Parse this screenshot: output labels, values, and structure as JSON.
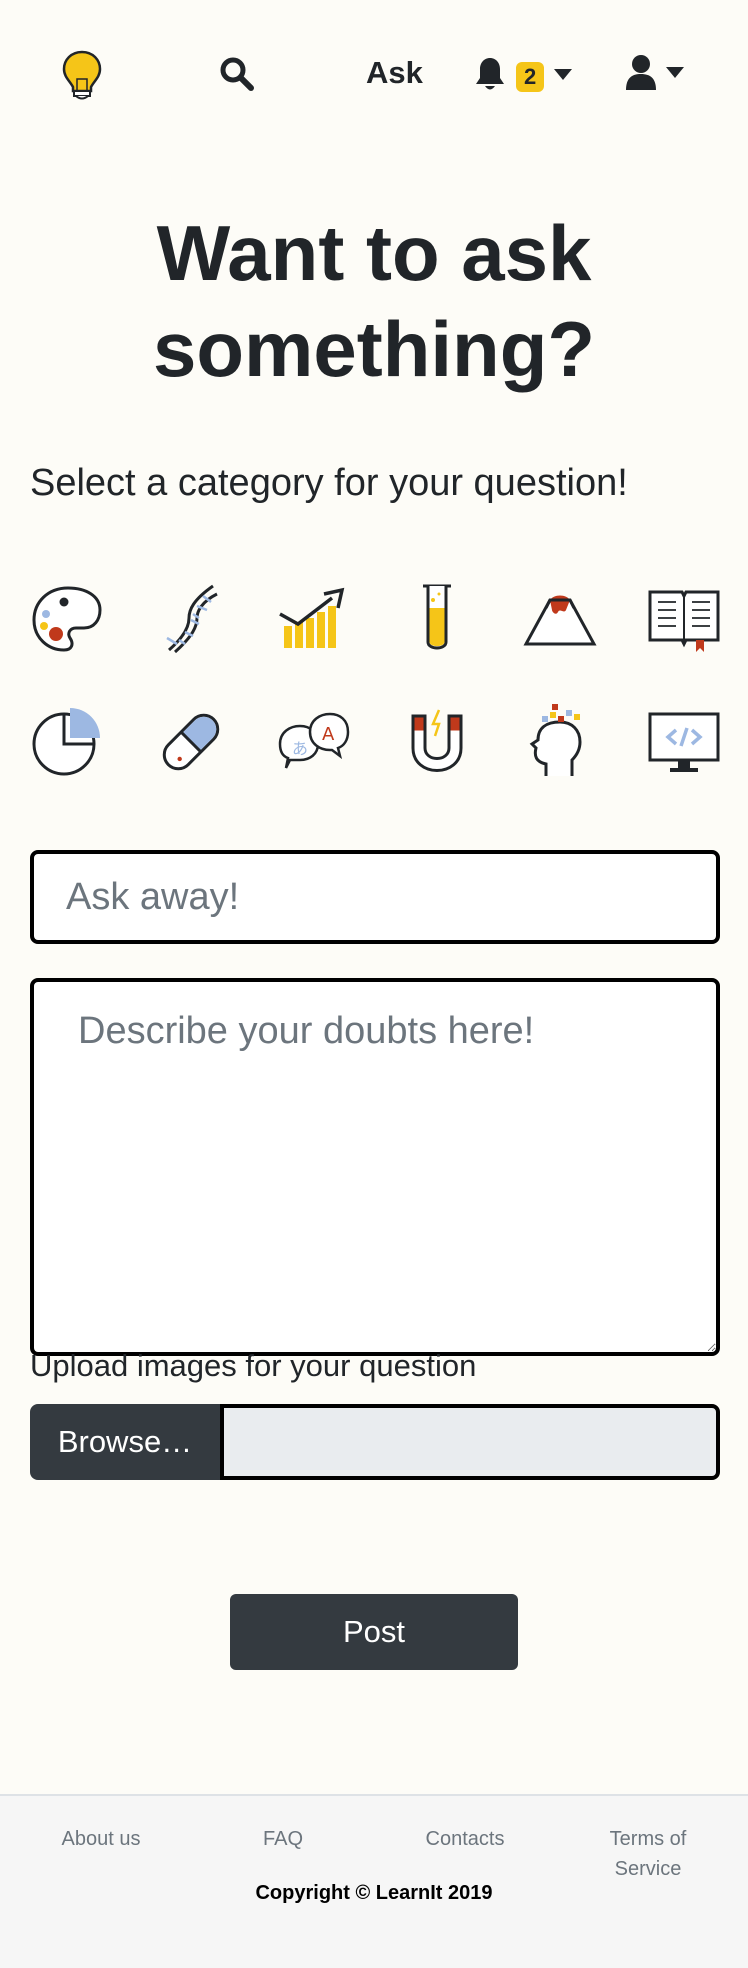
{
  "nav": {
    "logo_icon": "lightbulb-icon",
    "search_icon": "search-icon",
    "ask_label": "Ask",
    "notifications_icon": "bell-icon",
    "notification_count": "2",
    "user_icon": "user-icon"
  },
  "main": {
    "title": "Want to ask something?",
    "subtitle": "Select a category for your question!",
    "categories": [
      {
        "icon": "palette-icon"
      },
      {
        "icon": "dna-icon"
      },
      {
        "icon": "growth-chart-icon"
      },
      {
        "icon": "test-tube-icon"
      },
      {
        "icon": "volcano-icon"
      },
      {
        "icon": "book-icon"
      },
      {
        "icon": "pie-chart-icon"
      },
      {
        "icon": "pill-icon"
      },
      {
        "icon": "language-chat-icon"
      },
      {
        "icon": "magnet-icon"
      },
      {
        "icon": "head-icon"
      },
      {
        "icon": "computer-code-icon"
      }
    ],
    "question_placeholder": "Ask away!",
    "description_placeholder": "Describe your doubts here!",
    "upload_label": "Upload images for your question",
    "browse_label": "Browse…",
    "post_label": "Post"
  },
  "footer": {
    "links": [
      "About us",
      "FAQ",
      "Contacts",
      "Terms of Service"
    ],
    "copyright": "Copyright © LearnIt 2019"
  },
  "colors": {
    "background": "#fdfcf7",
    "accent_yellow": "#f5c518",
    "dark_button": "#343a40",
    "accent_red": "#c0391b",
    "accent_blue": "#9db8e2"
  }
}
